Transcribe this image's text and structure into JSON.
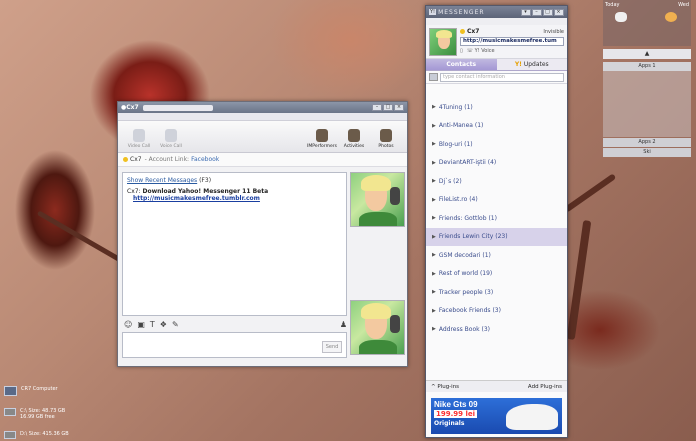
{
  "chat_window": {
    "title": "Cx7",
    "toolbar": {
      "video_call": "Video Call",
      "voice_call": "Voice Call",
      "im_performers": "IMPerformers",
      "activities": "Activities",
      "photos": "Photos"
    },
    "contact_name": "Cx7",
    "account_link_label": "- Account Link:",
    "account_link": "Facebook",
    "recent_link": "Show Recent Messages",
    "recent_count": "(F3)",
    "message_sender": "Cx7:",
    "message_text": "Download Yahoo! Messenger 11 Beta",
    "message_url": "http://musicmakesmefree.tumblr.com",
    "send_label": "Send"
  },
  "messenger": {
    "title": "MESSENGER",
    "logo": "Y!",
    "profile_name": "Cx7",
    "status_mode": "Invisible",
    "status_message": "http://musicmakesmefree.tum",
    "voice_label": "Y! Voice",
    "tabs": [
      {
        "label": "Contacts"
      },
      {
        "label": "Updates",
        "prefix": "Y!"
      }
    ],
    "search_placeholder": "type contact information",
    "groups": [
      {
        "label": "4Tuning (1)"
      },
      {
        "label": "Anti-Manea (1)"
      },
      {
        "label": "Blog-uri (1)"
      },
      {
        "label": "DeviantART-iştii (4)"
      },
      {
        "label": "Dj`s (2)"
      },
      {
        "label": "FileList.ro (4)"
      },
      {
        "label": "Friends: Gottlob (1)"
      },
      {
        "label": "Friends Lewin City (23)"
      },
      {
        "label": "GSM decodari (1)"
      },
      {
        "label": "Rest of world (19)"
      },
      {
        "label": "Tracker people (3)"
      },
      {
        "label": "Facebook Friends (3)"
      },
      {
        "label": "Address Book (3)"
      }
    ],
    "active_group_index": 7,
    "plugins_label": "Plug-ins",
    "add_plugins_label": "Add Plug-ins",
    "ad": {
      "title": "Nike Gts 09",
      "price": "199.99 lei",
      "brand": "Originals"
    }
  },
  "widget": {
    "today": "Today",
    "wed": "Wed",
    "apps1": "Apps 1",
    "apps2": "Apps 2",
    "ski": "Ski"
  },
  "desktop": {
    "computer": "CR7 Computer",
    "drive_c": "C:\\ Size: 48.73 GB",
    "drive_c_free": "16.99 GB free",
    "drive_d": "D:\\ Size: 415.36 GB"
  }
}
